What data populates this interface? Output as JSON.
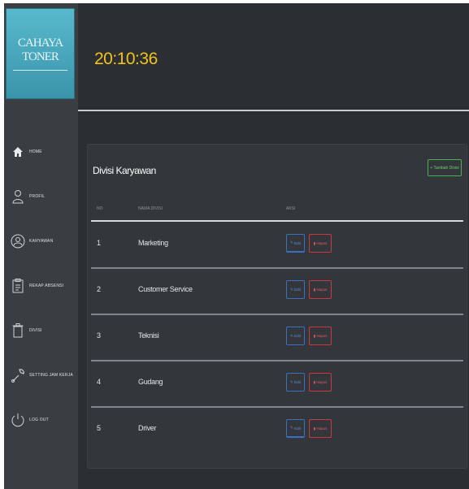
{
  "app": {
    "logo_text": "CAHAYA TONER"
  },
  "header": {
    "clock": "20:10:36"
  },
  "sidebar": {
    "items": [
      {
        "label": "HOME",
        "icon": "home-icon"
      },
      {
        "label": "PROFIL",
        "icon": "user-icon"
      },
      {
        "label": "KARYAWAN",
        "icon": "user-circle-icon"
      },
      {
        "label": "REKAP ABSENSI",
        "icon": "clipboard-icon"
      },
      {
        "label": "DIVISI",
        "icon": "trash-icon"
      },
      {
        "label": "SETTING JAM KERJA",
        "icon": "wrench-icon"
      },
      {
        "label": "LOG OUT",
        "icon": "power-icon"
      }
    ]
  },
  "card": {
    "title": "Divisi Karyawan",
    "add_button": "+ Tambah Divisi",
    "columns": [
      "NO",
      "NAMA DIVISI",
      "AKSI"
    ],
    "edit_label": "Edit",
    "delete_label": "Hapus",
    "rows": [
      {
        "no": "1",
        "name": "Marketing"
      },
      {
        "no": "2",
        "name": "Customer Service"
      },
      {
        "no": "3",
        "name": "Teknisi"
      },
      {
        "no": "4",
        "name": "Gudang"
      },
      {
        "no": "5",
        "name": "Driver"
      }
    ]
  },
  "colors": {
    "accent": "#f2c21b",
    "primary": "#3b6fc4",
    "danger": "#c73a45",
    "success": "#4caf50",
    "logo_bg": "#4aa9be"
  }
}
